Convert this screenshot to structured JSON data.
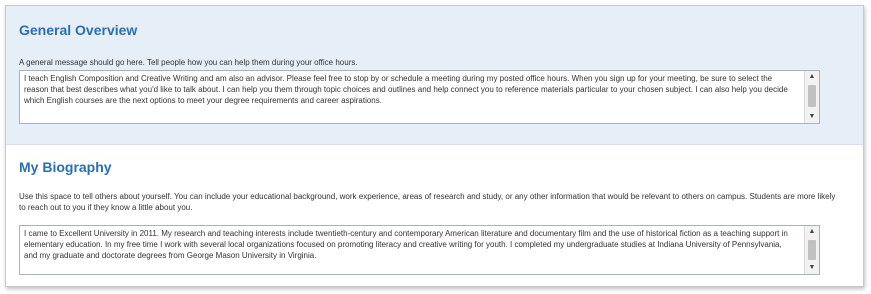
{
  "general_overview": {
    "title": "General Overview",
    "description": "A general message should go here. Tell people how you can help them during your office hours.",
    "text": "I teach English Composition and Creative Writing and am also an advisor. Please feel free to stop by or schedule a meeting during my posted office hours. When you sign up for your meeting, be sure to select the reason that best describes what you'd like to talk about. I can help you them through topic choices and outlines and help connect you to reference materials particular to your chosen subject. I can also help you decide which English courses are the next options to meet your degree requirements and career aspirations.",
    "scroll_position": 0.3
  },
  "my_biography": {
    "title": "My Biography",
    "description": "Use this space to tell others about yourself. You can include your educational background, work experience, areas of research and study, or any other information that would be relevant to others on campus. Students are more likely to reach out to you if they know a little about you.",
    "text": "I came to Excellent University in 2011. My research and teaching interests include twentieth-century and contemporary American literature and documentary film and the use of historical fiction as a teaching support in elementary education. In my free time I work with several local organizations focused on promoting literacy and creative writing for youth. I completed my undergraduate studies at Indiana University of Pennsylvania, and my graduate and doctorate degrees from George Mason University in Virginia.",
    "scroll_position": 0.3
  },
  "icons": {
    "scroll_up": "▲",
    "scroll_down": "▼"
  }
}
